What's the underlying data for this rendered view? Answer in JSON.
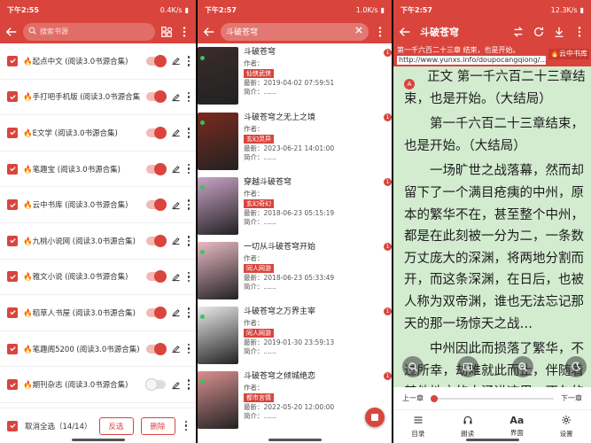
{
  "left_screen": {
    "status": {
      "time": "下午2:55",
      "speed": "0.4K/s",
      "battery": "■"
    },
    "search": {
      "placeholder": "搜索书源"
    },
    "sources": [
      {
        "name": "起点中文 (阅读3.0书源合集)",
        "enabled": true
      },
      {
        "name": "手打吧手机版 (阅读3.0书源合集)",
        "enabled": true
      },
      {
        "name": "E文学 (阅读3.0书源合集)",
        "enabled": true
      },
      {
        "name": "笔趣宝 (阅读3.0书源合集)",
        "enabled": true
      },
      {
        "name": "云中书库 (阅读3.0书源合集)",
        "enabled": true
      },
      {
        "name": "九桃小说网 (阅读3.0书源合集)",
        "enabled": true
      },
      {
        "name": "雅文小说 (阅读3.0书源合集)",
        "enabled": true
      },
      {
        "name": "稻草人书屋 (阅读3.0书源合集)",
        "enabled": true
      },
      {
        "name": "笔趣阁5200 (阅读3.0书源合集)",
        "enabled": true
      },
      {
        "name": "期刊杂志 (阅读3.0书源合集)",
        "enabled": false
      }
    ],
    "bottom": {
      "select_label": "取消全选（14/14）",
      "invert": "反选",
      "delete": "删除"
    }
  },
  "middle_screen": {
    "status": {
      "time": "下午2:57",
      "speed": "1.0K/s"
    },
    "search": {
      "value": "斗破苍穹"
    },
    "author_label": "作者：",
    "latest_label": "最新：",
    "intro_label": "简介：......",
    "books": [
      {
        "title": "斗破苍穹",
        "tag": "仙侠武侠",
        "date": "2019-04-02 07:59:51",
        "cover": "#3a2b2b",
        "badge": "1",
        "dot": true
      },
      {
        "title": "斗破苍穹之无上之境",
        "tag": "玄幻灵异",
        "date": "2023-06-21 14:01:00",
        "cover": "#7a2a1e",
        "badge": "1",
        "dot": true
      },
      {
        "title": "穿越斗破苍穹",
        "tag": "玄幻奇幻",
        "date": "2018-06-23 05:15:19",
        "cover": "#c9a3c7",
        "badge": "1",
        "dot": true
      },
      {
        "title": "一切从斗破苍穹开始",
        "tag": "同人网游",
        "date": "2018-06-23 05:33:49",
        "cover": "#e9b9c6",
        "badge": "1",
        "dot": true
      },
      {
        "title": "斗破苍穹之万界主宰",
        "tag": "同人网游",
        "date": "2019-01-30 23:59:13",
        "cover": "#e8e8e8",
        "badge": "1",
        "dot": true
      },
      {
        "title": "斗破苍穹之倾城绝恋",
        "tag": "都市言情",
        "date": "2022-05-20 12:00:00",
        "cover": "#d98f8f",
        "badge": "1",
        "dot": true
      }
    ]
  },
  "right_screen": {
    "status": {
      "time": "下午2:57",
      "speed": "12.3K/s"
    },
    "title": "斗破苍穹",
    "chapter_header": "第一千六百二十三章 结束，也是开始。",
    "url": "http://www.yunxs.info/doupocangqiong/...",
    "source_tag": "云中书库",
    "paragraphs": [
      "正文 第一千六百二十三章结束，也是开始。（大结局）",
      "第一千六百二十三章结束，也是开始。（大结局）",
      "一场旷世之战落幕，然而却留下了一个满目疮痍的中州，原本的繁华不在，甚至整个中州，都是在此刻被一分为二，一条数万丈庞大的深渊，将两地分割而开，而这条深渊，在日后，也被人称为双帝渊，谁也无法忘记那天的那一场惊天之战…",
      "中州因此而损落了繁华，不过所幸，劫难就此而止，伴随着其他地方的人涌进这里，不久的将来，这中州，依然会成为斗气"
    ],
    "prev_chapter": "上一章",
    "next_chapter": "下一章",
    "progress": 0,
    "tools": [
      {
        "label": "目录",
        "icon": "list-icon"
      },
      {
        "label": "朗读",
        "icon": "headphones-icon"
      },
      {
        "label": "界面",
        "icon": "font-icon"
      },
      {
        "label": "设置",
        "icon": "gear-icon"
      }
    ]
  }
}
